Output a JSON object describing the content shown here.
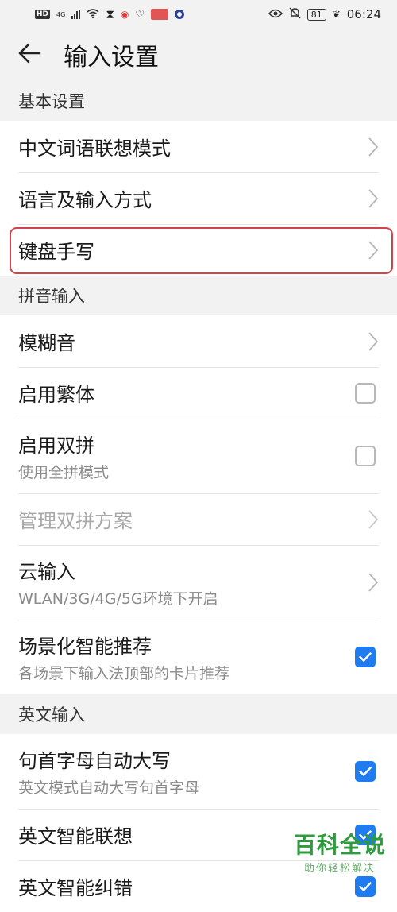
{
  "status_bar": {
    "hd": "HD",
    "network": "4G",
    "time": "06:24",
    "battery": "81"
  },
  "header": {
    "title": "输入设置"
  },
  "sections": {
    "basic": {
      "title": "基本设置",
      "items": [
        {
          "label": "中文词语联想模式"
        },
        {
          "label": "语言及输入方式"
        },
        {
          "label": "键盘手写"
        }
      ]
    },
    "pinyin": {
      "title": "拼音输入",
      "items": [
        {
          "label": "模糊音"
        },
        {
          "label": "启用繁体",
          "checked": false
        },
        {
          "label": "启用双拼",
          "sub": "使用全拼模式",
          "checked": false
        },
        {
          "label": "管理双拼方案"
        },
        {
          "label": "云输入",
          "sub": "WLAN/3G/4G/5G环境下开启"
        },
        {
          "label": "场景化智能推荐",
          "sub": "各场景下输入法顶部的卡片推荐",
          "checked": true
        }
      ]
    },
    "english": {
      "title": "英文输入",
      "items": [
        {
          "label": "句首字母自动大写",
          "sub": "英文模式自动大写句首字母",
          "checked": true
        },
        {
          "label": "英文智能联想",
          "checked": true
        },
        {
          "label": "英文智能纠错",
          "checked": true
        }
      ]
    }
  },
  "watermark": {
    "title": "百科全说",
    "subtitle": "助你轻松解决"
  },
  "colors": {
    "accent": "#1e7cf0",
    "highlight": "#d0454c"
  }
}
